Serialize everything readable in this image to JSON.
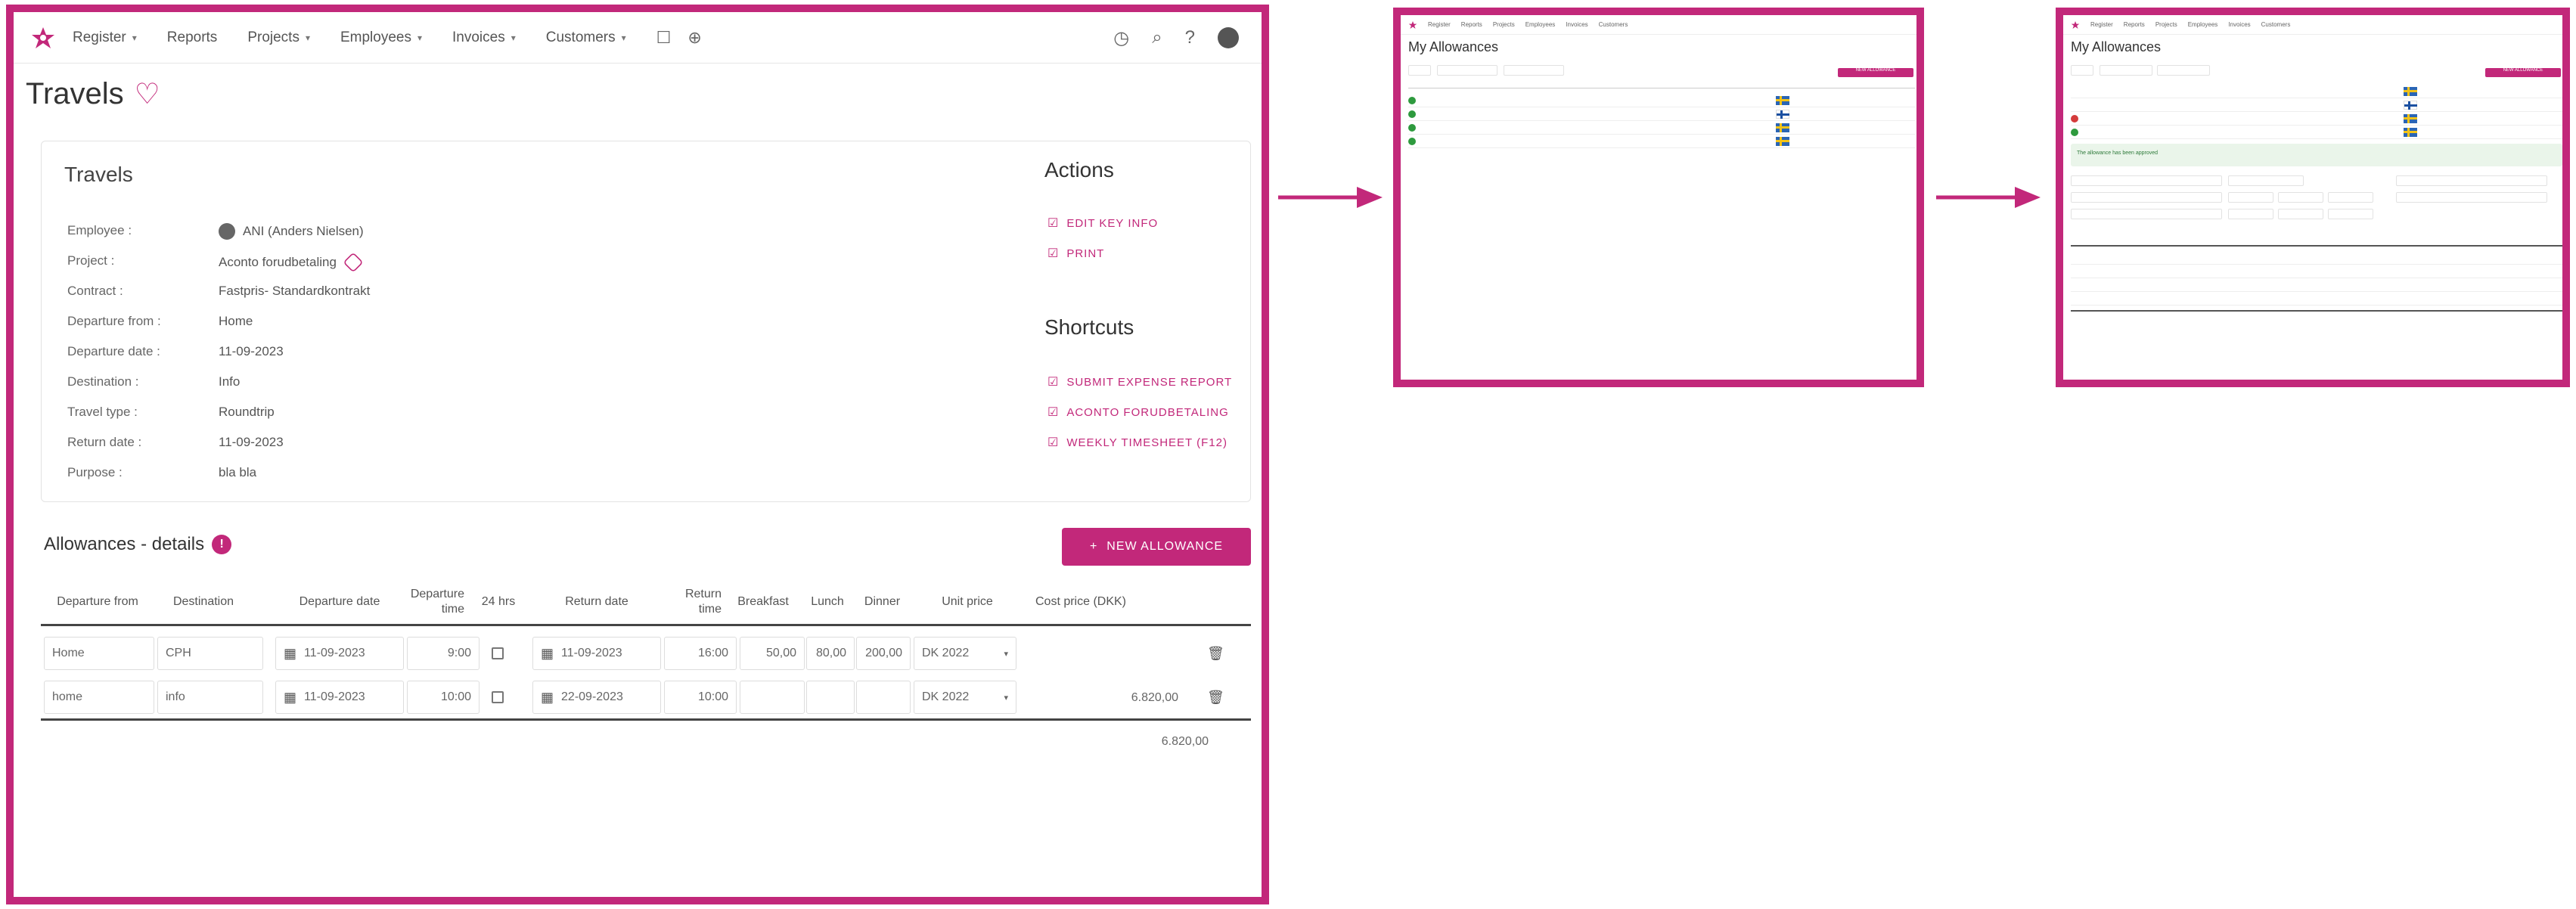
{
  "nav": {
    "items": [
      {
        "label": "Register",
        "chevron": true
      },
      {
        "label": "Reports",
        "chevron": false
      },
      {
        "label": "Projects",
        "chevron": true
      },
      {
        "label": "Employees",
        "chevron": true
      },
      {
        "label": "Invoices",
        "chevron": true
      },
      {
        "label": "Customers",
        "chevron": true
      }
    ]
  },
  "page": {
    "title": "Travels"
  },
  "travels": {
    "section_title": "Travels",
    "fields": [
      {
        "key": "Employee :",
        "value": "ANI (Anders Nielsen)"
      },
      {
        "key": "Project :",
        "value": "Aconto forudbetaling"
      },
      {
        "key": "Contract :",
        "value": "Fastpris- Standardkontrakt"
      },
      {
        "key": "Departure from :",
        "value": "Home"
      },
      {
        "key": "Departure date :",
        "value": "11-09-2023"
      },
      {
        "key": "Destination :",
        "value": "Info"
      },
      {
        "key": "Travel type :",
        "value": "Roundtrip"
      },
      {
        "key": "Return date :",
        "value": "11-09-2023"
      },
      {
        "key": "Purpose :",
        "value": "bla bla"
      }
    ]
  },
  "actions": {
    "title": "Actions",
    "links": [
      "EDIT KEY INFO",
      "PRINT"
    ]
  },
  "shortcuts": {
    "title": "Shortcuts",
    "links": [
      "SUBMIT EXPENSE REPORT",
      "ACONTO FORUDBETALING",
      "WEEKLY TIMESHEET (F12)"
    ]
  },
  "allowances": {
    "title": "Allowances - details",
    "new_button": "NEW ALLOWANCE",
    "headers": [
      "Departure from",
      "Destination",
      "Departure date",
      "Departure time",
      "24 hrs",
      "Return date",
      "Return time",
      "Breakfast",
      "Lunch",
      "Dinner",
      "Unit price",
      "Cost price (DKK)"
    ],
    "rows": [
      {
        "from": "Home",
        "dest": "CPH",
        "dep_date": "11-09-2023",
        "dep_time": "9:00",
        "ret_date": "11-09-2023",
        "ret_time": "16:00",
        "breakfast": "50,00",
        "lunch": "80,00",
        "dinner": "200,00",
        "unit": "DK 2022",
        "cost": ""
      },
      {
        "from": "home",
        "dest": "info",
        "dep_date": "11-09-2023",
        "dep_time": "10:00",
        "ret_date": "22-09-2023",
        "ret_time": "10:00",
        "breakfast": "",
        "lunch": "",
        "dinner": "",
        "unit": "DK 2022",
        "cost": "6.820,00"
      }
    ],
    "total": "6.820,00"
  },
  "mini1": {
    "title": "My Allowances",
    "button": "NEW ALLOWANCE"
  },
  "mini2": {
    "title": "My Allowances",
    "button": "NEW ALLOWANCE",
    "notice": "The allowance has been approved"
  },
  "colors": {
    "accent": "#c2287a",
    "green": "#2e9a3e"
  }
}
